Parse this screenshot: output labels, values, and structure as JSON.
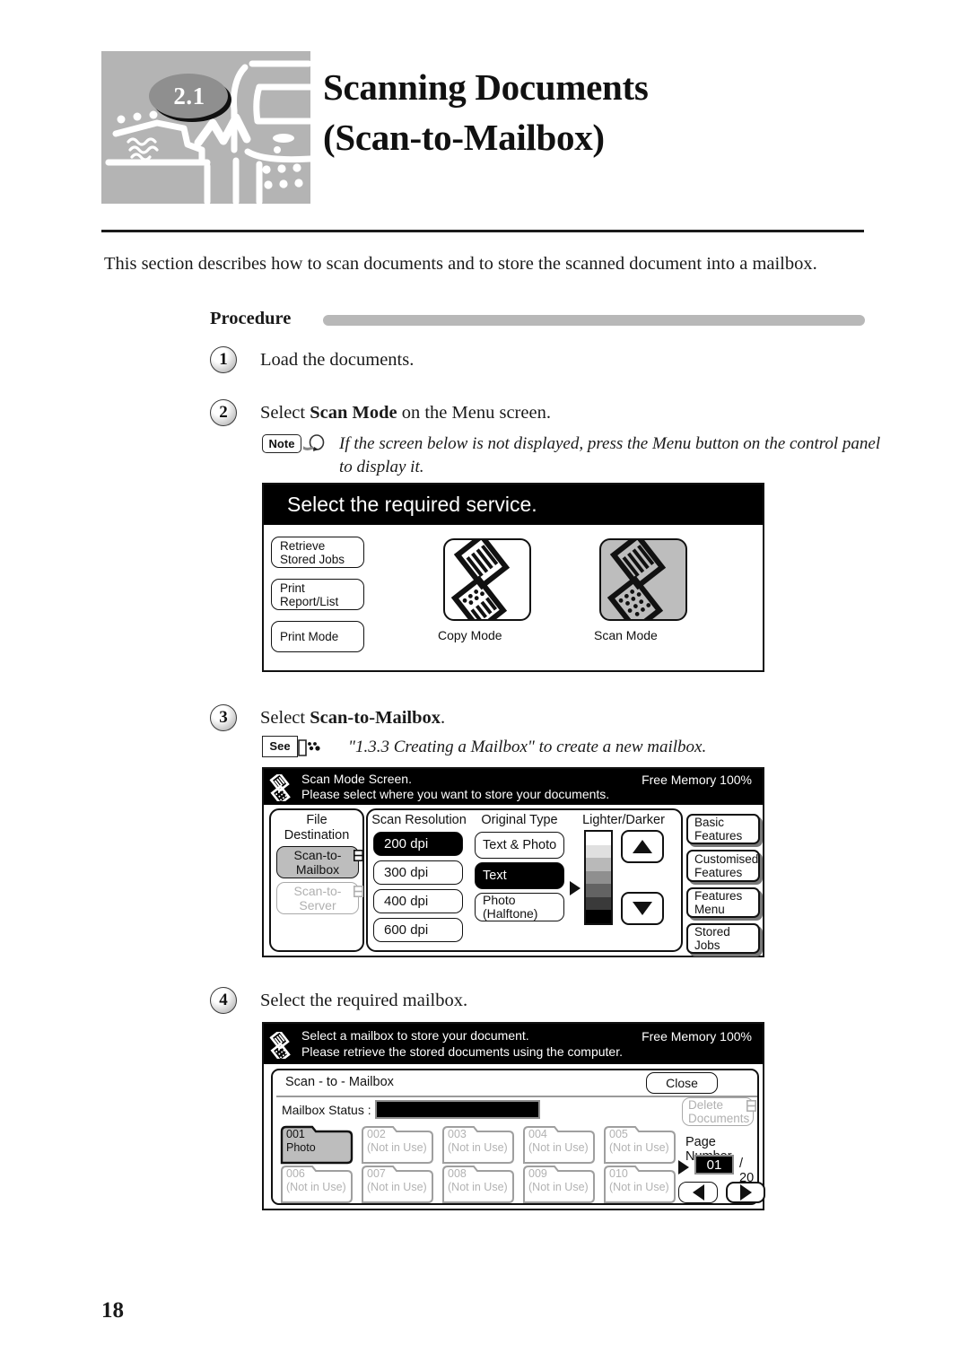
{
  "header": {
    "chapter_number": "2.1",
    "title_line1": "Scanning Documents",
    "title_line2": "(Scan-to-Mailbox)"
  },
  "intro": "This section describes how to scan documents and to store the scanned document into a mailbox.",
  "procedure": {
    "label": "Procedure"
  },
  "steps": [
    {
      "number": "1",
      "text": "Load the documents."
    },
    {
      "number": "2",
      "text_before": "Select ",
      "text_bold": "Scan Mode",
      "text_after": " on the Menu screen."
    },
    {
      "number": "3",
      "text_before": "Select ",
      "text_bold": "Scan-to-Mailbox",
      "text_after": "."
    },
    {
      "number": "4",
      "text": "Select the required mailbox."
    }
  ],
  "note": {
    "tag": "Note",
    "line1": "If the screen below is not displayed, press the Menu button on the control panel",
    "line2": "to display it."
  },
  "see": {
    "tag": "See",
    "text": "\"1.3.3  Creating a Mailbox\" to create a new mailbox."
  },
  "screen_service": {
    "title": "Select the required service.",
    "buttons": [
      {
        "line1": "Retrieve",
        "line2": "Stored Jobs"
      },
      {
        "line1": "Print",
        "line2": "Report/List"
      },
      {
        "line1": "Print Mode",
        "line2": ""
      }
    ],
    "tiles": [
      {
        "label": "Copy Mode",
        "selected": false
      },
      {
        "label": "Scan Mode",
        "selected": true
      }
    ]
  },
  "screen_scanmode": {
    "title_line1": "Scan Mode Screen.",
    "title_line2": "Please select where you want to store your documents.",
    "free_memory": "Free Memory  100%",
    "file_destination": {
      "heading_line1": "File",
      "heading_line2": "Destination",
      "options": [
        {
          "line1": "Scan-to-",
          "line2": "Mailbox",
          "state": "selected"
        },
        {
          "line1": "Scan-to-",
          "line2": "Server",
          "state": "disabled"
        }
      ]
    },
    "scan_resolution": {
      "heading": "Scan Resolution",
      "options": [
        {
          "label": "200 dpi",
          "selected": true
        },
        {
          "label": "300 dpi",
          "selected": false
        },
        {
          "label": "400 dpi",
          "selected": false
        },
        {
          "label": "600 dpi",
          "selected": false
        }
      ]
    },
    "original_type": {
      "heading": "Original Type",
      "options": [
        {
          "line1": "Text & Photo",
          "line2": "",
          "selected": false
        },
        {
          "line1": "Text",
          "line2": "",
          "selected": true
        },
        {
          "line1": "Photo",
          "line2": "(Halftone)",
          "selected": false
        }
      ]
    },
    "lighter_darker": {
      "heading": "Lighter/Darker",
      "steps": 7,
      "current_step": 4,
      "up_icon": "triangle-up-icon",
      "down_icon": "triangle-down-icon"
    },
    "side_tabs": [
      {
        "line1": "Basic Features",
        "line2": ""
      },
      {
        "line1": "Customised",
        "line2": "Features"
      },
      {
        "line1": "Features Menu",
        "line2": ""
      },
      {
        "line1": "Stored Jobs",
        "line2": ""
      }
    ]
  },
  "screen_mailbox": {
    "title_line1": "Select a mailbox to store your document.",
    "title_line2": "Please retrieve the stored documents using the computer.",
    "free_memory": "Free Memory  100%",
    "panel_title": "Scan - to - Mailbox",
    "close_label": "Close",
    "status_label": "Mailbox Status :",
    "delete_label_line1": "Delete",
    "delete_label_line2": "Documents",
    "page_number_label": "Page Number",
    "page_current": "01",
    "page_total": "/ 20",
    "mailboxes": [
      {
        "id": "001",
        "name": "Photo",
        "selected": true
      },
      {
        "id": "002",
        "name": "(Not in Use)",
        "selected": false
      },
      {
        "id": "003",
        "name": "(Not in Use)",
        "selected": false
      },
      {
        "id": "004",
        "name": "(Not in Use)",
        "selected": false
      },
      {
        "id": "005",
        "name": "(Not in Use)",
        "selected": false
      },
      {
        "id": "006",
        "name": "(Not in Use)",
        "selected": false
      },
      {
        "id": "007",
        "name": "(Not in Use)",
        "selected": false
      },
      {
        "id": "008",
        "name": "(Not in Use)",
        "selected": false
      },
      {
        "id": "009",
        "name": "(Not in Use)",
        "selected": false
      },
      {
        "id": "010",
        "name": "(Not in Use)",
        "selected": false
      }
    ]
  },
  "footer": {
    "page_number": "18"
  }
}
